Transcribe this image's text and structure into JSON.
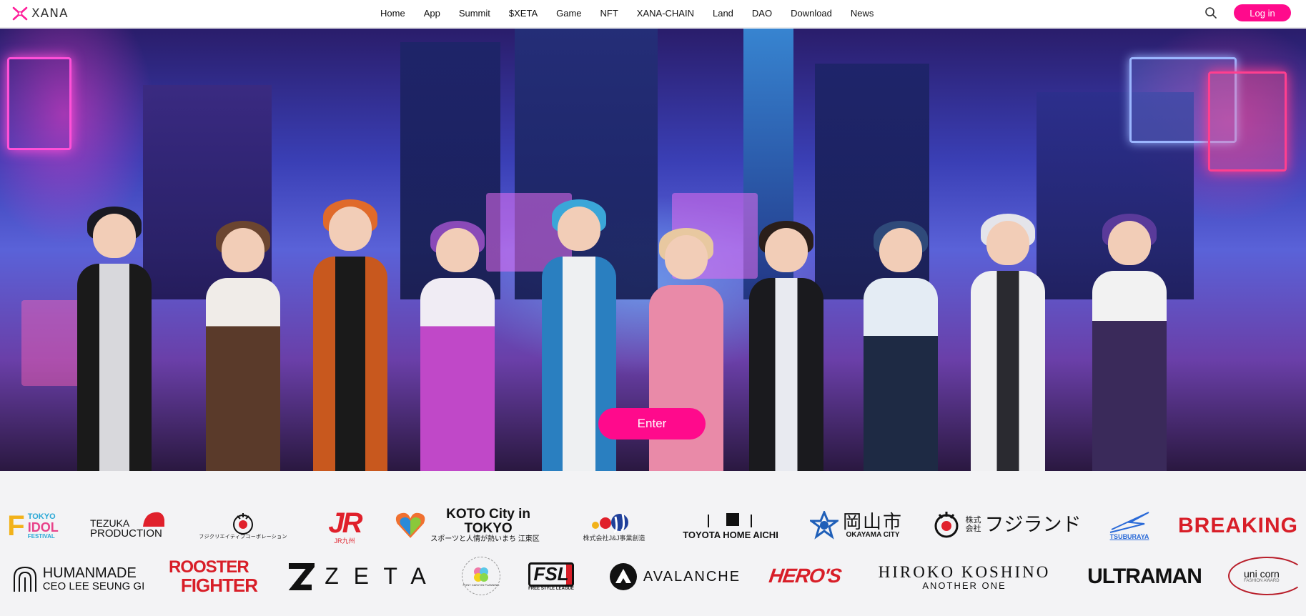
{
  "header": {
    "brand": "XANA",
    "nav": [
      "Home",
      "App",
      "Summit",
      "$XETA",
      "Game",
      "NFT",
      "XANA-CHAIN",
      "Land",
      "DAO",
      "Download",
      "News"
    ],
    "login_label": "Log in"
  },
  "hero": {
    "enter_label": "Enter"
  },
  "partners": {
    "row1": [
      {
        "name": "tokyo-idol-festival",
        "lines": [
          "TOKYO",
          "IDOL",
          "FESTIVAL"
        ]
      },
      {
        "name": "tezuka-production",
        "lines": [
          "TEZUKA",
          "PRODUCTION"
        ]
      },
      {
        "name": "fcc-fuji-creative",
        "lines": [
          "フジクリエイティブコーポレーション"
        ]
      },
      {
        "name": "jr-kyushu",
        "lines": [
          "JR",
          "JR九州"
        ]
      },
      {
        "name": "koto-city-tokyo",
        "lines": [
          "KOTO City in TOKYO",
          "スポーツと人情が熱いまち 江東区"
        ]
      },
      {
        "name": "jj-business",
        "lines": [
          "株式会社J&J事業創造"
        ]
      },
      {
        "name": "toyota-home-aichi",
        "lines": [
          "TOYOTA HOME AICHI"
        ]
      },
      {
        "name": "okayama-city",
        "lines": [
          "岡山市",
          "OKAYAMA CITY"
        ]
      },
      {
        "name": "fujiland",
        "lines": [
          "株式会社",
          "フジランド"
        ]
      },
      {
        "name": "tsuburaya",
        "lines": [
          "TSUBURAYA"
        ]
      },
      {
        "name": "breaking-down",
        "lines": [
          "BREAKING DO"
        ]
      }
    ],
    "row2": [
      {
        "name": "humanmade",
        "lines": [
          "HUMANMADE",
          "CEO LEE SEUNG GI"
        ]
      },
      {
        "name": "rooster-fighter",
        "lines": [
          "ROOSTER",
          "FIGHTER"
        ]
      },
      {
        "name": "zeta",
        "lines": [
          "Z E T A"
        ]
      },
      {
        "name": "pony-canyon",
        "lines": [
          "PONY CANYON PLANNING"
        ]
      },
      {
        "name": "free-style-league",
        "lines": [
          "FSL",
          "FREE STYLE LEAGUE"
        ]
      },
      {
        "name": "avalanche",
        "lines": [
          "AVALANCHE"
        ]
      },
      {
        "name": "heros",
        "lines": [
          "HERO'S"
        ]
      },
      {
        "name": "hiroko-koshino",
        "lines": [
          "HIROKO KOSHINO",
          "ANOTHER ONE"
        ]
      },
      {
        "name": "ultraman",
        "lines": [
          "ULTRAMAN"
        ]
      },
      {
        "name": "unicorn",
        "lines": [
          "uni corn",
          "FASHION AWARD"
        ]
      }
    ]
  },
  "colors": {
    "accent": "#ff0a8c",
    "page_bg": "#f3f3f5",
    "brand_red": "#e0202b"
  }
}
